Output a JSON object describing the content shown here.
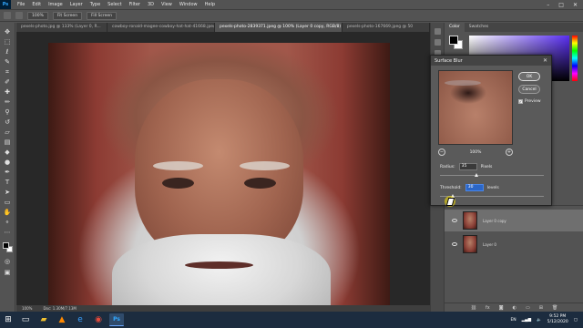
{
  "menu": {
    "app_logo": "Ps",
    "items": [
      "File",
      "Edit",
      "Image",
      "Layer",
      "Type",
      "Select",
      "Filter",
      "3D",
      "View",
      "Window",
      "Help"
    ],
    "window_controls": [
      "–",
      "□",
      "✕"
    ]
  },
  "options_bar": {
    "zoom_value": "100%",
    "fit_screen_label": "Fit Screen",
    "fill_screen_label": "Fill Screen"
  },
  "document_tabs": [
    "pexels-photo.jpg @ 133% (Layer 0, R...",
    "cowboy-ronald-magee-cowboy-hat-hat-41668.jpeg",
    "pexels-photo-2839371.jpeg @ 100% (Layer 0 copy, RGB/8) *",
    "pexels-photo-167669.jpeg @ 50"
  ],
  "active_tab_index": 2,
  "status_bar": {
    "zoom": "100%",
    "doc_info": "Doc: 1.30M/7.13M"
  },
  "right_panel": {
    "tabs": [
      "Color",
      "Swatches"
    ],
    "layers": [
      {
        "name": "Layer 0 copy",
        "selected": true
      },
      {
        "name": "Layer 0",
        "selected": false
      }
    ],
    "layer_footer_icons": [
      "link-icon",
      "fx-icon",
      "mask-icon",
      "adjustment-icon",
      "folder-icon",
      "new-layer-icon",
      "trash-icon"
    ]
  },
  "dialog": {
    "title": "Surface Blur",
    "ok_label": "OK",
    "cancel_label": "Cancel",
    "preview_label": "Preview",
    "preview_checked": true,
    "zoom_level": "100%",
    "radius_label": "Radius:",
    "radius_value": "35",
    "radius_unit": "Pixels",
    "threshold_label": "Threshold:",
    "threshold_value": "30",
    "threshold_unit": "levels",
    "radius_slider_fraction": 0.35,
    "threshold_slider_fraction": 0.12
  },
  "taskbar": {
    "apps": [
      "windows-start",
      "task-view",
      "file-explorer",
      "vlc",
      "edge",
      "chrome",
      "photoshop"
    ],
    "language": "EN",
    "time": "9:52 PM",
    "date": "5/12/2020"
  },
  "colors": {
    "accent_selection": "#2b66c7",
    "app_bg": "#535353",
    "taskbar": "#1c2c3f"
  }
}
